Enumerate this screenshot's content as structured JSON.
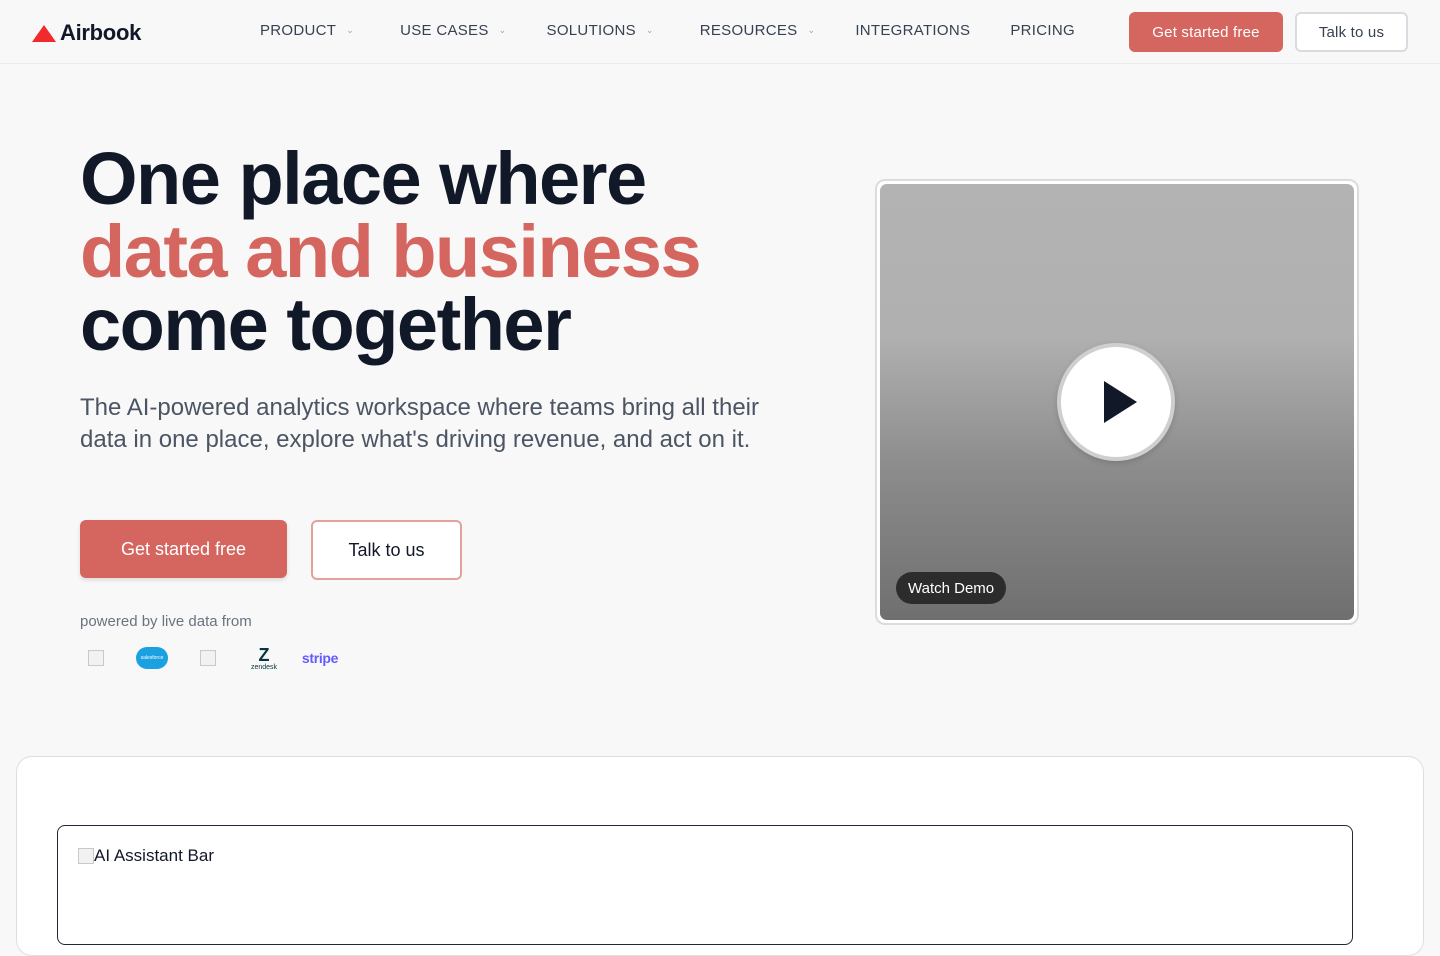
{
  "nav": {
    "brand": "Airbook",
    "links": [
      {
        "label": "PRODUCT",
        "dropdown": true
      },
      {
        "label": "USE CASES",
        "dropdown": true
      },
      {
        "label": "SOLUTIONS",
        "dropdown": true
      },
      {
        "label": "RESOURCES",
        "dropdown": true
      },
      {
        "label": "INTEGRATIONS",
        "dropdown": false
      },
      {
        "label": "PRICING",
        "dropdown": false
      }
    ],
    "cta_primary": "Get started free",
    "cta_secondary": "Talk to us"
  },
  "hero": {
    "title_line1": "One place where",
    "title_line2": "data and business",
    "title_line3": "come together",
    "subtitle": "The AI-powered analytics workspace where teams bring all their data in one place, explore what's driving revenue, and act on it.",
    "cta_primary": "Get started free",
    "cta_secondary": "Talk to us",
    "powered_by": "powered by live data from",
    "logos": {
      "salesforce": "salesforce",
      "zendesk": "zendesk",
      "stripe": "stripe"
    }
  },
  "video": {
    "badge": "Watch Demo"
  },
  "preview": {
    "image_alt": "AI Assistant Bar"
  },
  "colors": {
    "accent": "#d5665f",
    "brand_mark": "#ef2b2b",
    "text_dark": "#111827"
  }
}
